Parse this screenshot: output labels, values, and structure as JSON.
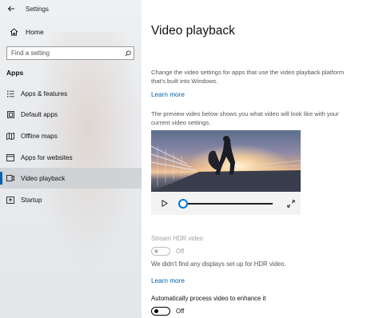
{
  "window": {
    "title": "Settings"
  },
  "sidebar": {
    "home_label": "Home",
    "search_placeholder": "Find a setting",
    "section_header": "Apps",
    "items": [
      {
        "label": "Apps & features",
        "icon": "list-icon"
      },
      {
        "label": "Default apps",
        "icon": "default-apps-icon"
      },
      {
        "label": "Offline maps",
        "icon": "map-icon"
      },
      {
        "label": "Apps for websites",
        "icon": "web-app-icon"
      },
      {
        "label": "Video playback",
        "icon": "video-icon",
        "selected": true
      },
      {
        "label": "Startup",
        "icon": "startup-icon"
      }
    ]
  },
  "main": {
    "title": "Video playback",
    "description": "Change the video settings for apps that use the video playback platform that's built into Windows.",
    "learn_more_1": "Learn more",
    "preview_description": "The preview video below shows you what video will look like with your current video settings.",
    "video": {
      "progress": 0.05
    },
    "hdr": {
      "label": "Stream HDR video",
      "state": "Off",
      "enabled": false
    },
    "hdr_message": "We didn't find any displays set up for HDR video.",
    "learn_more_2": "Learn more",
    "auto_process": {
      "label": "Automatically process video to enhance it",
      "state": "Off",
      "enabled": true
    }
  },
  "colors": {
    "accent": "#0063b1",
    "sidebar_bg": "#e9ecef",
    "selected_bg": "#cdd0d4"
  }
}
